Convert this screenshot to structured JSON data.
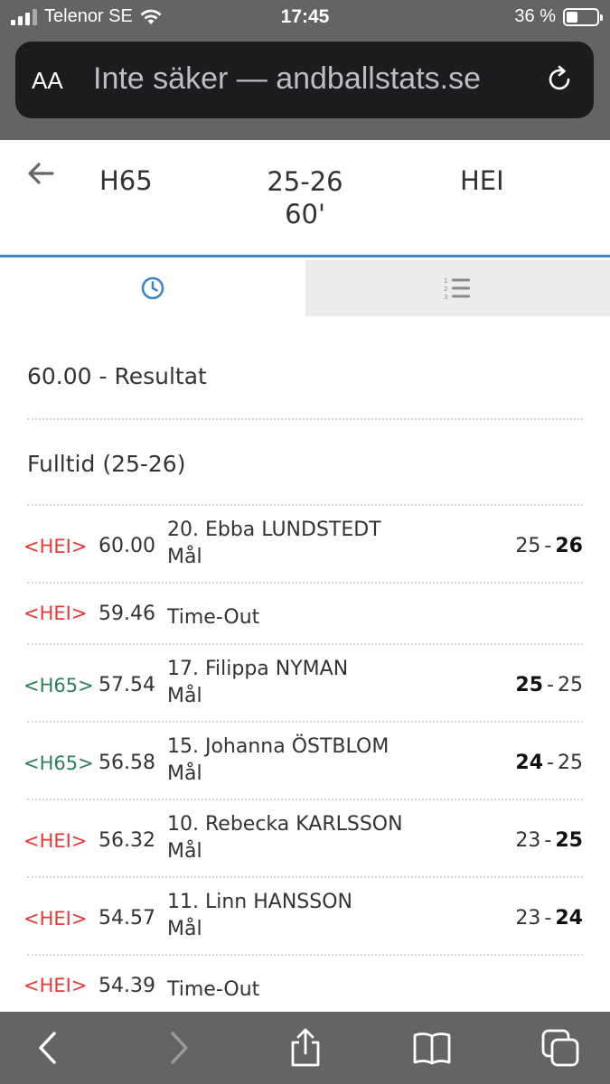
{
  "status_bar": {
    "carrier": "Telenor SE",
    "time": "17:45",
    "battery_text": "36 %",
    "battery_level": 0.36
  },
  "browser": {
    "aa_label": "AA",
    "url": "Inte säker — andballstats.se"
  },
  "match": {
    "home_team": "H65",
    "away_team": "HEI",
    "score": "25-26",
    "time": "60'"
  },
  "tabs": [
    {
      "icon": "clock-icon",
      "active": true
    },
    {
      "icon": "numbered-list-icon",
      "active": false
    }
  ],
  "sections": {
    "result": "60.00 - Resultat",
    "fulltime": "Fulltid (25-26)"
  },
  "colors": {
    "accent": "#3f86c4",
    "hei": "#e53935",
    "h65": "#2e7d5b"
  },
  "events": [
    {
      "team": "<HEI>",
      "team_class": "hei",
      "time": "60.00",
      "player": "20. Ebba LUNDSTEDT",
      "type": "Mål",
      "score_home": "25",
      "score_away": "26",
      "bold": "away"
    },
    {
      "team": "<HEI>",
      "team_class": "hei",
      "time": "59.46",
      "player": "",
      "type": "Time-Out",
      "score_home": "",
      "score_away": "",
      "bold": ""
    },
    {
      "team": "<H65>",
      "team_class": "h65",
      "time": "57.54",
      "player": "17. Filippa NYMAN",
      "type": "Mål",
      "score_home": "25",
      "score_away": "25",
      "bold": "home"
    },
    {
      "team": "<H65>",
      "team_class": "h65",
      "time": "56.58",
      "player": "15. Johanna ÖSTBLOM",
      "type": "Mål",
      "score_home": "24",
      "score_away": "25",
      "bold": "home"
    },
    {
      "team": "<HEI>",
      "team_class": "hei",
      "time": "56.32",
      "player": "10. Rebecka KARLSSON",
      "type": "Mål",
      "score_home": "23",
      "score_away": "25",
      "bold": "away"
    },
    {
      "team": "<HEI>",
      "team_class": "hei",
      "time": "54.57",
      "player": "11. Linn HANSSON",
      "type": "Mål",
      "score_home": "23",
      "score_away": "24",
      "bold": "away"
    },
    {
      "team": "<HEI>",
      "team_class": "hei",
      "time": "54.39",
      "player": "",
      "type": "Time-Out",
      "score_home": "",
      "score_away": "",
      "bold": ""
    }
  ],
  "score_separator": "-",
  "toolbar": [
    "back-icon",
    "forward-icon",
    "share-icon",
    "bookmarks-icon",
    "tabs-icon"
  ]
}
